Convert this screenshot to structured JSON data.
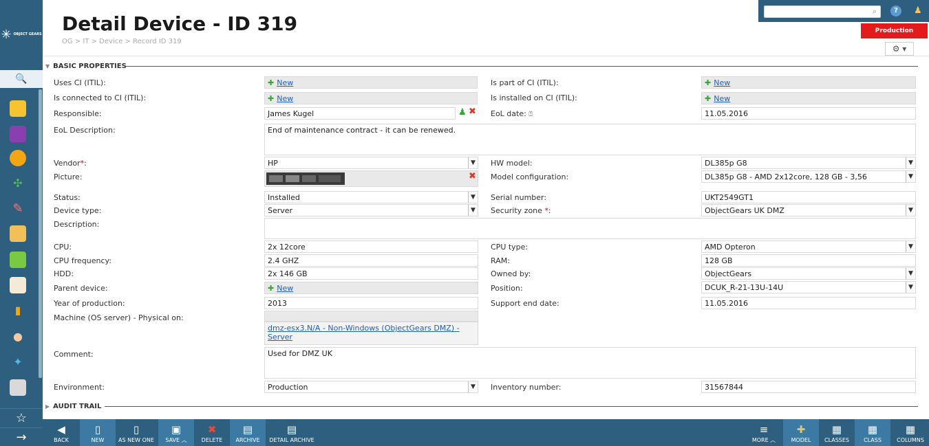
{
  "app": {
    "logo_text": "OBJECT GEARS",
    "page_title": "Detail Device - ID 319",
    "breadcrumb": "OG > IT > Device > Record ID 319",
    "environment_badge": "Production"
  },
  "section_basic": "BASIC PROPERTIES",
  "section_audit": "AUDIT TRAIL",
  "fields": {
    "uses_ci_label": "Uses CI (ITIL):",
    "is_part_of_ci_label": "Is part of CI (ITIL):",
    "is_connected_label": "Is connected to CI (ITIL):",
    "is_installed_label": "Is installed on CI (ITIL):",
    "responsible_label": "Responsible:",
    "responsible_value": "James Kugel",
    "eol_date_label": "EoL date:",
    "eol_date_value": "11.05.2016",
    "eol_desc_label": "EoL Description:",
    "eol_desc_value": "End of maintenance contract - it can be renewed.",
    "vendor_label": "Vendor",
    "vendor_value": "HP",
    "hw_model_label": "HW model:",
    "hw_model_value": "DL385p G8",
    "picture_label": "Picture:",
    "model_config_label": "Model configuration:",
    "model_config_value": "DL385p G8 - AMD 2x12core, 128 GB - 3,56",
    "status_label": "Status:",
    "status_value": "Installed",
    "serial_label": "Serial number:",
    "serial_value": "UKT2549GT1",
    "device_type_label": "Device type:",
    "device_type_value": "Server",
    "security_zone_label": "Security zone",
    "security_zone_value": "ObjectGears UK DMZ",
    "description_label": "Description:",
    "cpu_label": "CPU:",
    "cpu_value": "2x 12core",
    "cpu_type_label": "CPU type:",
    "cpu_type_value": "AMD Opteron",
    "cpu_freq_label": "CPU frequency:",
    "cpu_freq_value": "2.4 GHZ",
    "ram_label": "RAM:",
    "ram_value": "128 GB",
    "hdd_label": "HDD:",
    "hdd_value": "2x 146 GB",
    "owned_by_label": "Owned by:",
    "owned_by_value": "ObjectGears",
    "parent_device_label": "Parent device:",
    "position_label": "Position:",
    "position_value": "DCUK_R-21-13U-14U",
    "year_label": "Year of production:",
    "year_value": "2013",
    "support_end_label": "Support end date:",
    "support_end_value": "11.05.2016",
    "machine_label": "Machine (OS server) - Physical on:",
    "machine_value": "dmz-esx3.N/A - Non-Windows (ObjectGears DMZ) - Server",
    "comment_label": "Comment:",
    "comment_value": "Used for DMZ UK",
    "environment_label": "Environment:",
    "environment_value": "Production",
    "inventory_label": "Inventory number:",
    "inventory_value": "31567844",
    "new_link": "New",
    "required_mark": "*"
  },
  "toolbar": {
    "back": "BACK",
    "new": "NEW",
    "as_new_one": "AS NEW ONE",
    "save": "SAVE",
    "delete": "DELETE",
    "archive": "ARCHIVE",
    "detail_archive": "DETAIL ARCHIVE",
    "more": "MORE",
    "model": "MODEL",
    "classes": "CLASSES",
    "class": "CLASS",
    "columns": "COLUMNS"
  },
  "colors": {
    "sidebar": "#2e5f7e",
    "accent": "#3c7aa3",
    "badge": "#e21b1b"
  }
}
